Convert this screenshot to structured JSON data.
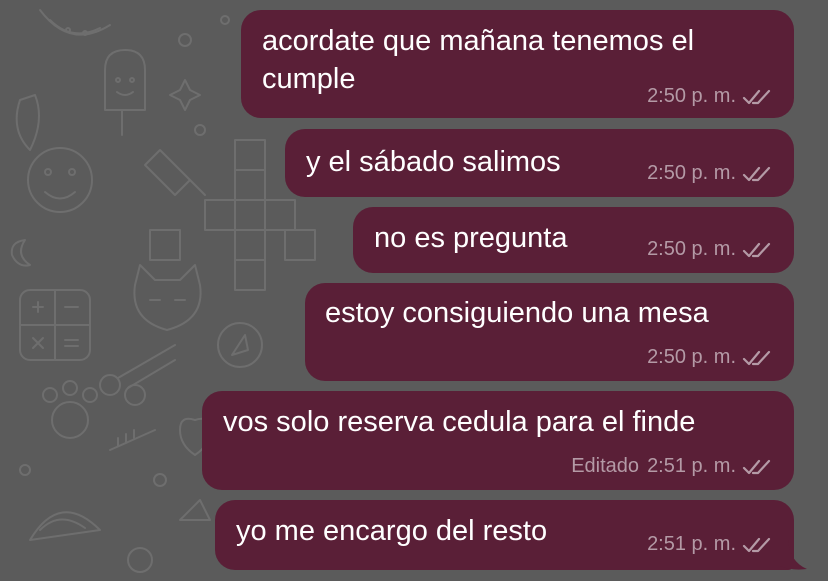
{
  "theme": {
    "bubble_color": "#5a1f37",
    "wallpaper_color": "#5b5b5b",
    "text_color": "#ffffff",
    "meta_color": "#b49aa6"
  },
  "messages": [
    {
      "lines": [
        "acordate que mañana tenemos el",
        "cumple"
      ],
      "time": "2:50 p. m.",
      "edited_label": "",
      "status": "read"
    },
    {
      "lines": [
        "y el sábado salimos"
      ],
      "time": "2:50 p. m.",
      "edited_label": "",
      "status": "read"
    },
    {
      "lines": [
        "no es pregunta"
      ],
      "time": "2:50 p. m.",
      "edited_label": "",
      "status": "read"
    },
    {
      "lines": [
        "estoy consiguiendo una mesa"
      ],
      "time": "2:50 p. m.",
      "edited_label": "",
      "status": "read"
    },
    {
      "lines": [
        "vos solo reserva cedula para el finde"
      ],
      "time": "2:51 p. m.",
      "edited_label": "Editado",
      "status": "read"
    },
    {
      "lines": [
        "yo me encargo del resto"
      ],
      "time": "2:51 p. m.",
      "edited_label": "",
      "status": "read"
    }
  ],
  "icons": {
    "read_receipt": "double-check-icon",
    "wallpaper": "doodle-pattern"
  }
}
